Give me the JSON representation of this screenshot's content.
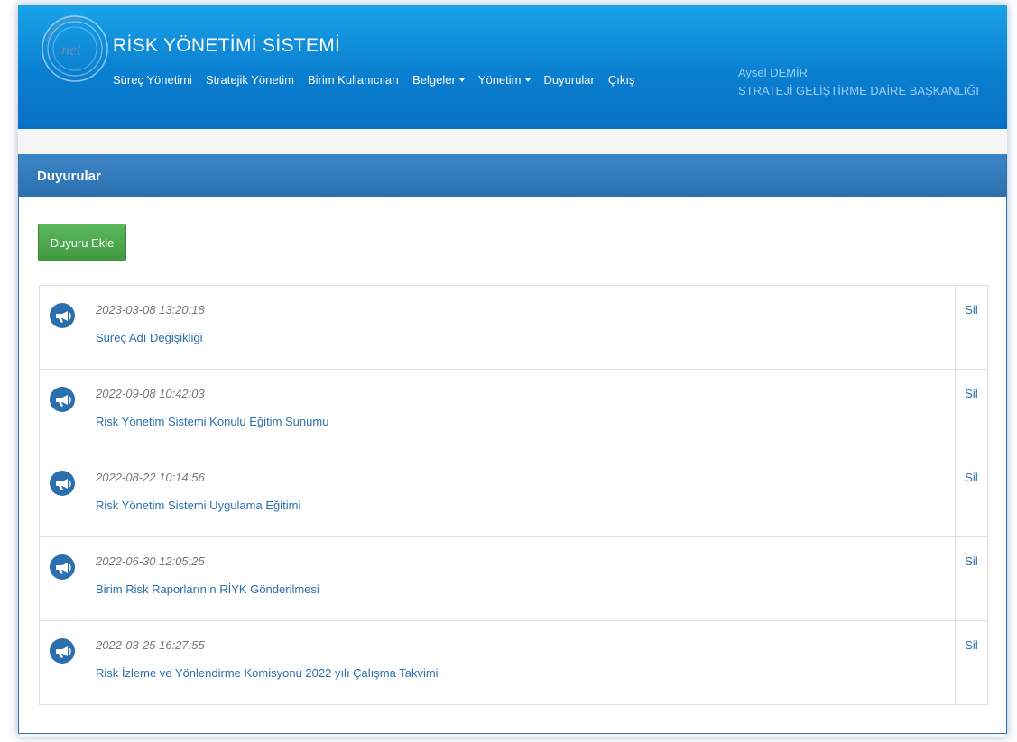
{
  "header": {
    "title": "RİSK YÖNETİMİ SİSTEMİ",
    "nav": [
      {
        "label": "Süreç Yönetimi",
        "dropdown": false
      },
      {
        "label": "Stratejik Yönetim",
        "dropdown": false
      },
      {
        "label": "Birim Kullanıcıları",
        "dropdown": false
      },
      {
        "label": "Belgeler",
        "dropdown": true
      },
      {
        "label": "Yönetim",
        "dropdown": true
      },
      {
        "label": "Duyurular",
        "dropdown": false
      },
      {
        "label": "Çıkış",
        "dropdown": false
      }
    ],
    "user_name": "Aysel DEMİR",
    "user_department": "STRATEJİ GELİŞTİRME DAİRE BAŞKANLIĞI",
    "logo_text": "net"
  },
  "panel": {
    "title": "Duyurular",
    "add_button": "Duyuru Ekle",
    "items": [
      {
        "date": "2023-03-08 13:20:18",
        "title": "Süreç Adı Değişikliği",
        "action": "Sil"
      },
      {
        "date": "2022-09-08 10:42:03",
        "title": "Risk Yönetim Sistemi Konulu Eğitim Sunumu",
        "action": "Sil"
      },
      {
        "date": "2022-08-22 10:14:56",
        "title": "Risk Yönetim Sistemi Uygulama Eğitimi",
        "action": "Sil"
      },
      {
        "date": "2022-06-30 12:05:25",
        "title": "Birim Risk Raporlarının RİYK Gönderilmesi",
        "action": "Sil"
      },
      {
        "date": "2022-03-25 16:27:55",
        "title": "Risk İzleme ve Yönlendirme Komisyonu 2022 yılı Çalışma Takvimi",
        "action": "Sil"
      }
    ],
    "item_icon": "megaphone-icon"
  },
  "colors": {
    "header_blue": "#0a7fd0",
    "panel_head": "#2b6fae",
    "add_green": "#5cb85c",
    "link_blue": "#2b6fae"
  }
}
